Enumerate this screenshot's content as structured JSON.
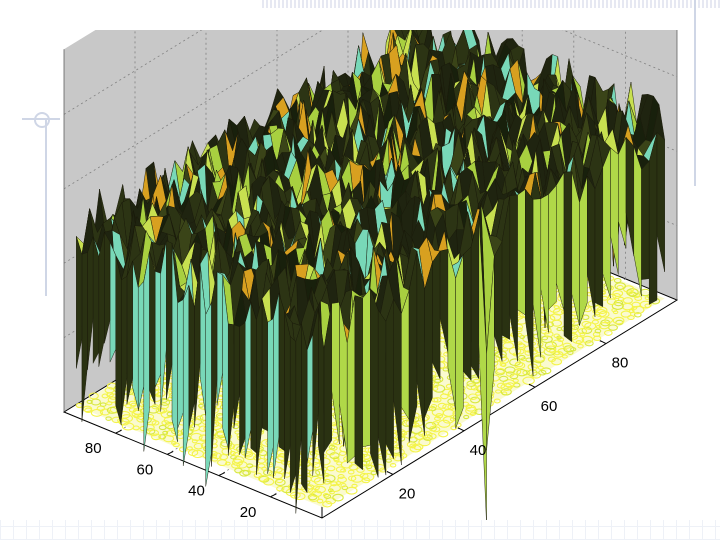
{
  "chart_data": {
    "type": "surface",
    "title": "",
    "xlabel": "",
    "ylabel": "",
    "zlabel": "",
    "grid": true,
    "x_ticks": [
      20,
      40,
      60,
      80
    ],
    "y_ticks": [
      20,
      40,
      60,
      80
    ],
    "xlim": [
      0,
      100
    ],
    "ylim": [
      0,
      100
    ],
    "series": [
      {
        "kind": "surface",
        "description": "noisy random surface, dark mesh with yellow-green and cyan facets"
      },
      {
        "kind": "contour",
        "description": "dense contour map projected at the base plane in yellow"
      }
    ],
    "colors": {
      "axes_background": "#c8c8c8",
      "surface_edge": "#1a1a0a",
      "surface_face": "#b8d848",
      "surface_face_alt": "#7fe0c8",
      "contour": "#f4f44a",
      "grid": "#808080"
    }
  }
}
